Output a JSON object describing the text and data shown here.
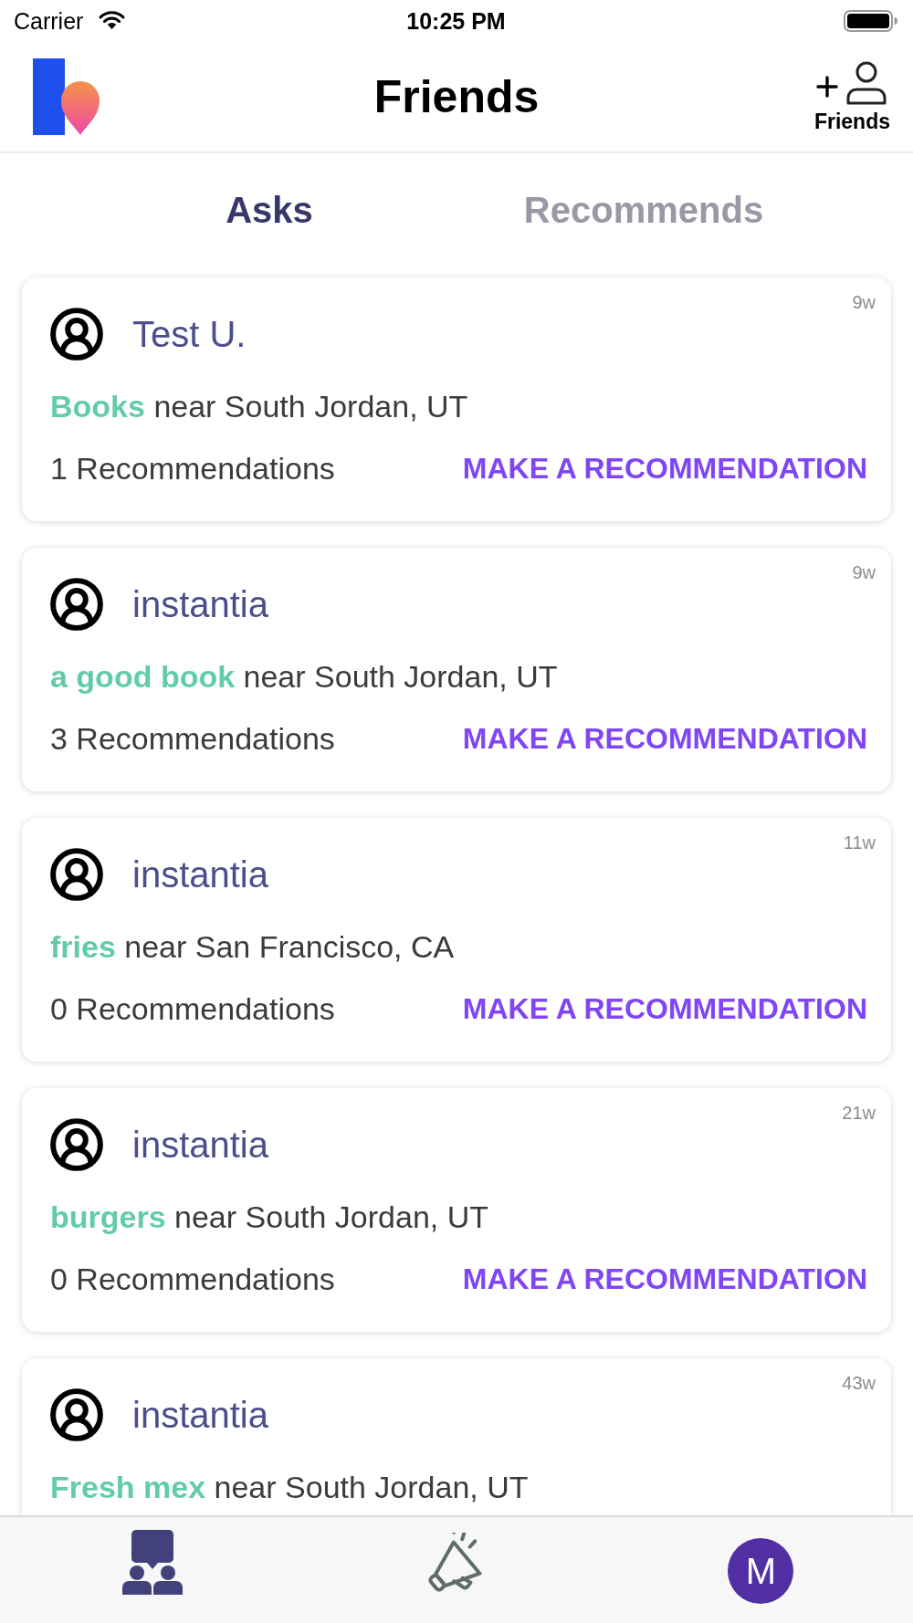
{
  "status_bar": {
    "carrier": "Carrier",
    "time": "10:25 PM"
  },
  "header": {
    "title": "Friends",
    "add_button": {
      "label": "Friends"
    }
  },
  "tabs": [
    {
      "label": "Asks",
      "selected": true
    },
    {
      "label": "Recommends",
      "selected": false
    }
  ],
  "asks": [
    {
      "user": "Test U.",
      "age": "9w",
      "topic": "Books",
      "place": "near South Jordan, UT",
      "recommendations": "1 Recommendations",
      "action": "MAKE A RECOMMENDATION"
    },
    {
      "user": "instantia",
      "age": "9w",
      "topic": "a good book",
      "place": "near South Jordan, UT",
      "recommendations": "3 Recommendations",
      "action": "MAKE A RECOMMENDATION"
    },
    {
      "user": "instantia",
      "age": "11w",
      "topic": "fries",
      "place": "near San Francisco, CA",
      "recommendations": "0 Recommendations",
      "action": "MAKE A RECOMMENDATION"
    },
    {
      "user": "instantia",
      "age": "21w",
      "topic": "burgers",
      "place": "near South Jordan, UT",
      "recommendations": "0 Recommendations",
      "action": "MAKE A RECOMMENDATION"
    },
    {
      "user": "instantia",
      "age": "43w",
      "topic": "Fresh mex",
      "place": "near South Jordan, UT"
    }
  ],
  "bottom_nav": [
    {
      "kind": "friends",
      "selected": true
    },
    {
      "kind": "broadcast",
      "selected": false
    },
    {
      "kind": "profile",
      "initial": "M",
      "selected": false
    }
  ]
}
